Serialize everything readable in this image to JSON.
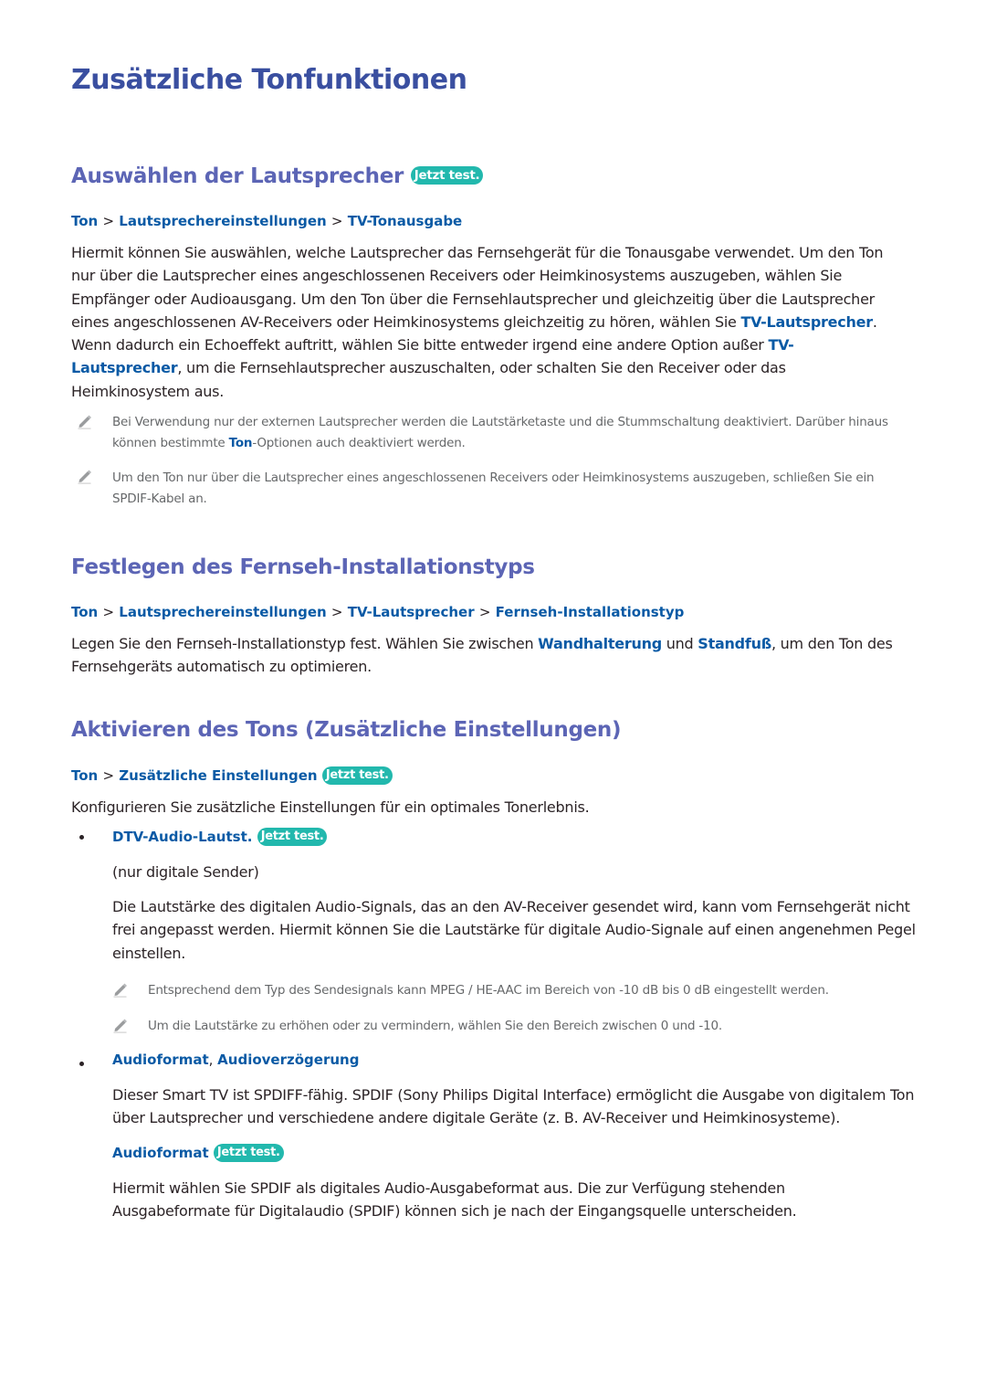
{
  "page_title": "Zusätzliche Tonfunktionen",
  "badge_label": "Jetzt test.",
  "colors": {
    "title": "#3a4fa0",
    "heading": "#5c65b5",
    "link": "#0a5aa5",
    "badge": "#22b8ad",
    "note_text": "#66686a",
    "body_text": "#2b2326"
  },
  "sections": [
    {
      "heading": "Auswählen der Lautsprecher",
      "has_badge": true,
      "path": [
        "Ton",
        "Lautsprechereinstellungen",
        "TV-Tonausgabe"
      ],
      "body": [
        "Hiermit können Sie auswählen, welche Lautsprecher das Fernsehgerät für die Tonausgabe verwendet. Um den Ton nur über die Lautsprecher eines angeschlossenen Receivers oder Heimkinosystems auszugeben, wählen Sie Empfänger oder Audioausgang. Um den Ton über die Fernsehlautsprecher und gleichzeitig über die Lautsprecher eines angeschlossenen AV-Receivers oder Heimkinosystems gleichzeitig zu hören, wählen Sie ",
        "TV-Lautsprecher",
        ". Wenn dadurch ein Echoeffekt auftritt, wählen Sie bitte entweder irgend eine andere Option außer ",
        "TV-Lautsprecher",
        ", um die Fernsehlautsprecher auszuschalten, oder schalten Sie den Receiver oder das Heimkinosystem aus."
      ],
      "notes": [
        {
          "parts": [
            "Bei Verwendung nur der externen Lautsprecher werden die Lautstärketaste und die Stummschaltung deaktiviert. Darüber hinaus können bestimmte ",
            "Ton",
            "-Optionen auch deaktiviert werden."
          ]
        },
        {
          "parts": [
            "Um den Ton nur über die Lautsprecher eines angeschlossenen Receivers oder Heimkinosystems auszugeben, schließen Sie ein SPDIF-Kabel an."
          ]
        }
      ]
    },
    {
      "heading": "Festlegen des Fernseh-Installationstyps",
      "has_badge": false,
      "path": [
        "Ton",
        "Lautsprechereinstellungen",
        "TV-Lautsprecher",
        "Fernseh-Installationstyp"
      ],
      "body": [
        "Legen Sie den Fernseh-Installationstyp fest. Wählen Sie zwischen ",
        "Wandhalterung",
        " und ",
        "Standfuß",
        ", um den Ton des Fernsehgeräts automatisch zu optimieren."
      ]
    },
    {
      "heading": "Aktivieren des Tons (Zusätzliche Einstellungen)",
      "has_badge": false,
      "path": [
        "Ton",
        "Zusätzliche Einstellungen"
      ],
      "path_badge": true,
      "body": [
        "Konfigurieren Sie zusätzliche Einstellungen für ein optimales Tonerlebnis."
      ],
      "items": [
        {
          "title": "DTV-Audio-Lautst.",
          "has_badge": true,
          "subtitle": "(nur digitale Sender)",
          "body": "Die Lautstärke des digitalen Audio-Signals, das an den AV-Receiver gesendet wird, kann vom Fernsehgerät nicht frei angepasst werden. Hiermit können Sie die Lautstärke für digitale Audio-Signale auf einen angenehmen Pegel einstellen.",
          "notes": [
            "Entsprechend dem Typ des Sendesignals kann MPEG / HE-AAC im Bereich von -10 dB bis 0 dB eingestellt werden.",
            "Um die Lautstärke zu erhöhen oder zu vermindern, wählen Sie den Bereich zwischen 0 und -10."
          ]
        },
        {
          "title_parts": [
            "Audioformat",
            ", ",
            "Audioverzögerung"
          ],
          "body": "Dieser Smart TV ist SPDIFF-fähig. SPDIF (Sony Philips Digital Interface) ermöglicht die Ausgabe von digitalem Ton über Lautsprecher und verschiedene andere digitale Geräte (z. B. AV-Receiver und Heimkinosysteme).",
          "subsection": {
            "title": "Audioformat",
            "has_badge": true,
            "body": "Hiermit wählen Sie SPDIF als digitales Audio-Ausgabeformat aus. Die zur Verfügung stehenden Ausgabeformate für Digitalaudio (SPDIF) können sich je nach der Eingangsquelle unterscheiden."
          }
        }
      ]
    }
  ],
  "separator": ">"
}
